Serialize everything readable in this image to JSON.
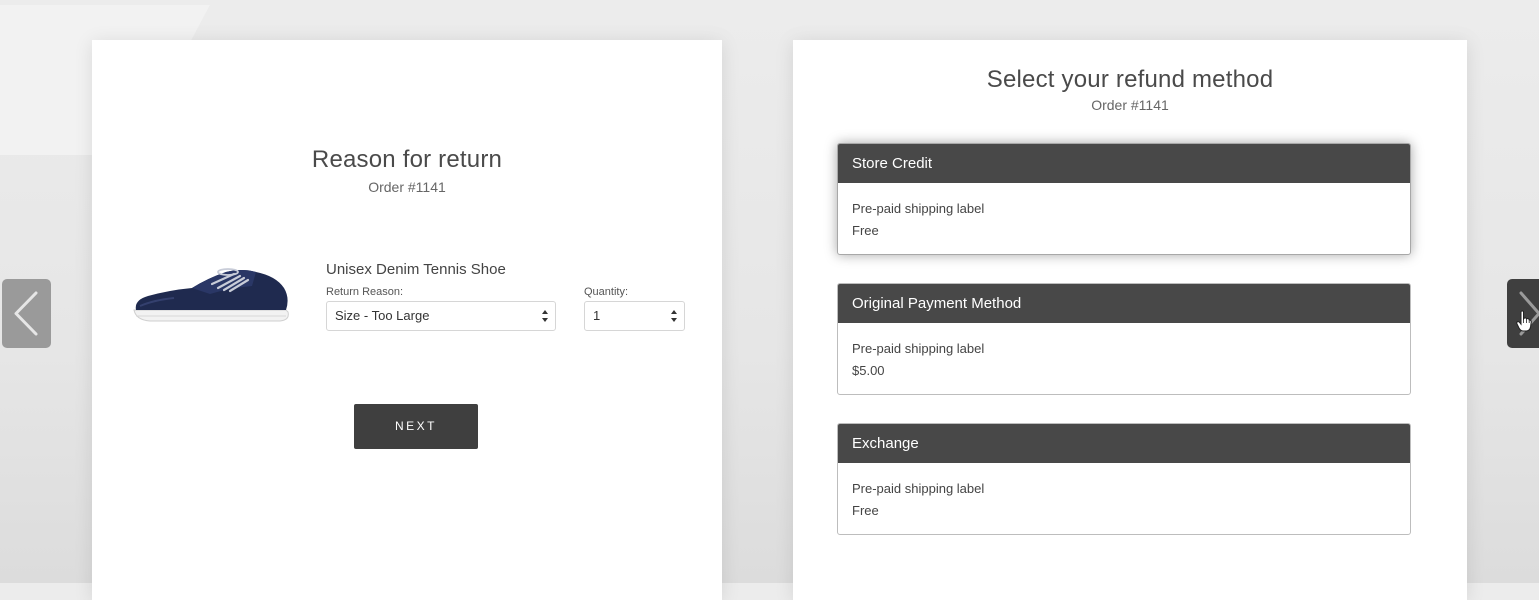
{
  "return_panel": {
    "title": "Reason for return",
    "order": "Order #1141",
    "product": {
      "name": "Unisex Denim Tennis Shoe",
      "image_icon": "sneaker-image"
    },
    "return_reason": {
      "label": "Return Reason:",
      "value": "Size - Too Large"
    },
    "quantity": {
      "label": "Quantity:",
      "value": "1"
    },
    "next_button": "NEXT"
  },
  "refund_panel": {
    "title": "Select your refund method",
    "order": "Order #1141",
    "options": [
      {
        "title": "Store Credit",
        "line1": "Pre-paid shipping label",
        "line2": "Free",
        "selected": true
      },
      {
        "title": "Original Payment Method",
        "line1": "Pre-paid shipping label",
        "line2": "$5.00",
        "selected": false
      },
      {
        "title": "Exchange",
        "line1": "Pre-paid shipping label",
        "line2": "Free",
        "selected": false
      }
    ]
  },
  "carousel": {
    "prev_icon": "chevron-left-icon",
    "next_icon": "chevron-right-icon",
    "cursor_icon": "hand-pointer-icon"
  },
  "colors": {
    "button_bg": "#3f3f3f",
    "option_header_bg": "#484848",
    "page_bg": "#e8e8e8",
    "panel_bg": "#ffffff"
  }
}
